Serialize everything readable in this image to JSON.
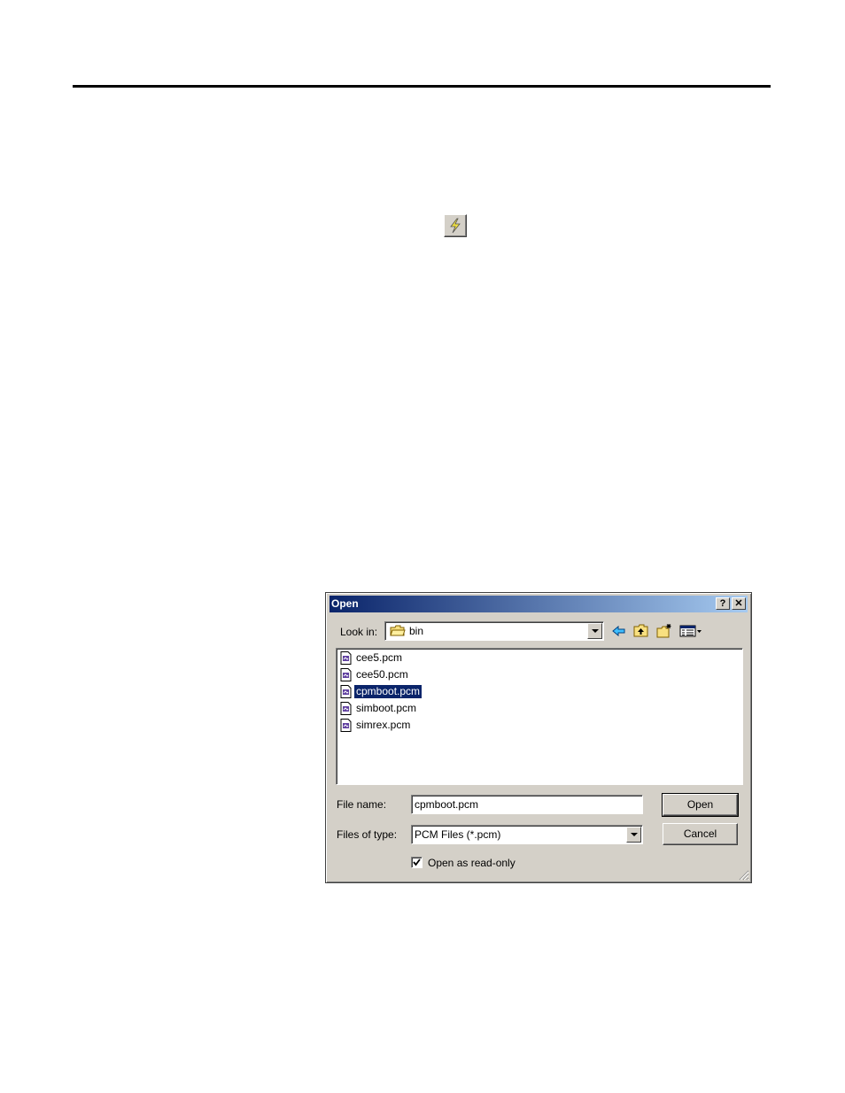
{
  "toolbar_icon": {
    "name": "lightning-bolt-icon"
  },
  "dialog": {
    "title": "Open",
    "help_label": "?",
    "close_label": "✕",
    "look_in_label": "Look in:",
    "look_in_value": "bin",
    "files": [
      {
        "name": "cee5.pcm",
        "selected": false
      },
      {
        "name": "cee50.pcm",
        "selected": false
      },
      {
        "name": "cpmboot.pcm",
        "selected": true
      },
      {
        "name": "simboot.pcm",
        "selected": false
      },
      {
        "name": "simrex.pcm",
        "selected": false
      }
    ],
    "file_name_label": "File name:",
    "file_name_value": "cpmboot.pcm",
    "files_of_type_label": "Files of type:",
    "files_of_type_value": "PCM Files (*.pcm)",
    "open_button": "Open",
    "cancel_button": "Cancel",
    "readonly_label": "Open as read-only",
    "readonly_checked": true
  },
  "colors": {
    "titlebar_start": "#0a246a",
    "titlebar_end": "#a6caf0",
    "face": "#d4d0c8",
    "selection": "#0a246a"
  }
}
